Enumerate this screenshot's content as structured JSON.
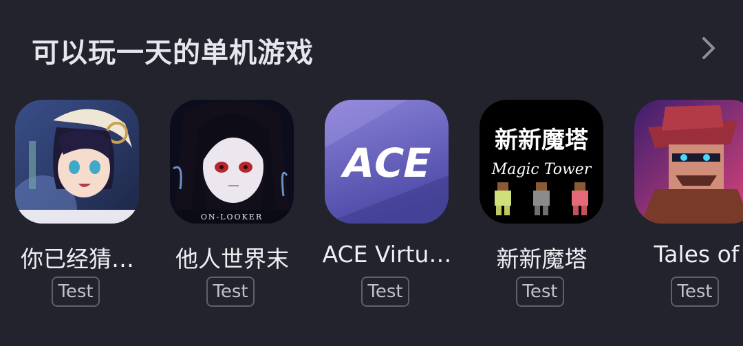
{
  "section": {
    "title": "可以玩一天的单机游戏"
  },
  "apps": [
    {
      "name": "你已经猜…",
      "tag": "Test"
    },
    {
      "name": "他人世界末",
      "tag": "Test",
      "icon_text": "ON-LOOKER"
    },
    {
      "name": "ACE Virtu…",
      "tag": "Test",
      "icon_text": "ACE"
    },
    {
      "name": "新新魔塔",
      "tag": "Test",
      "icon_text": "新新魔塔",
      "icon_subtext": "Magic Tower"
    },
    {
      "name": "Tales of",
      "tag": "Test"
    }
  ],
  "colors": {
    "background": "#22232d",
    "tag_border": "#5e6070"
  }
}
